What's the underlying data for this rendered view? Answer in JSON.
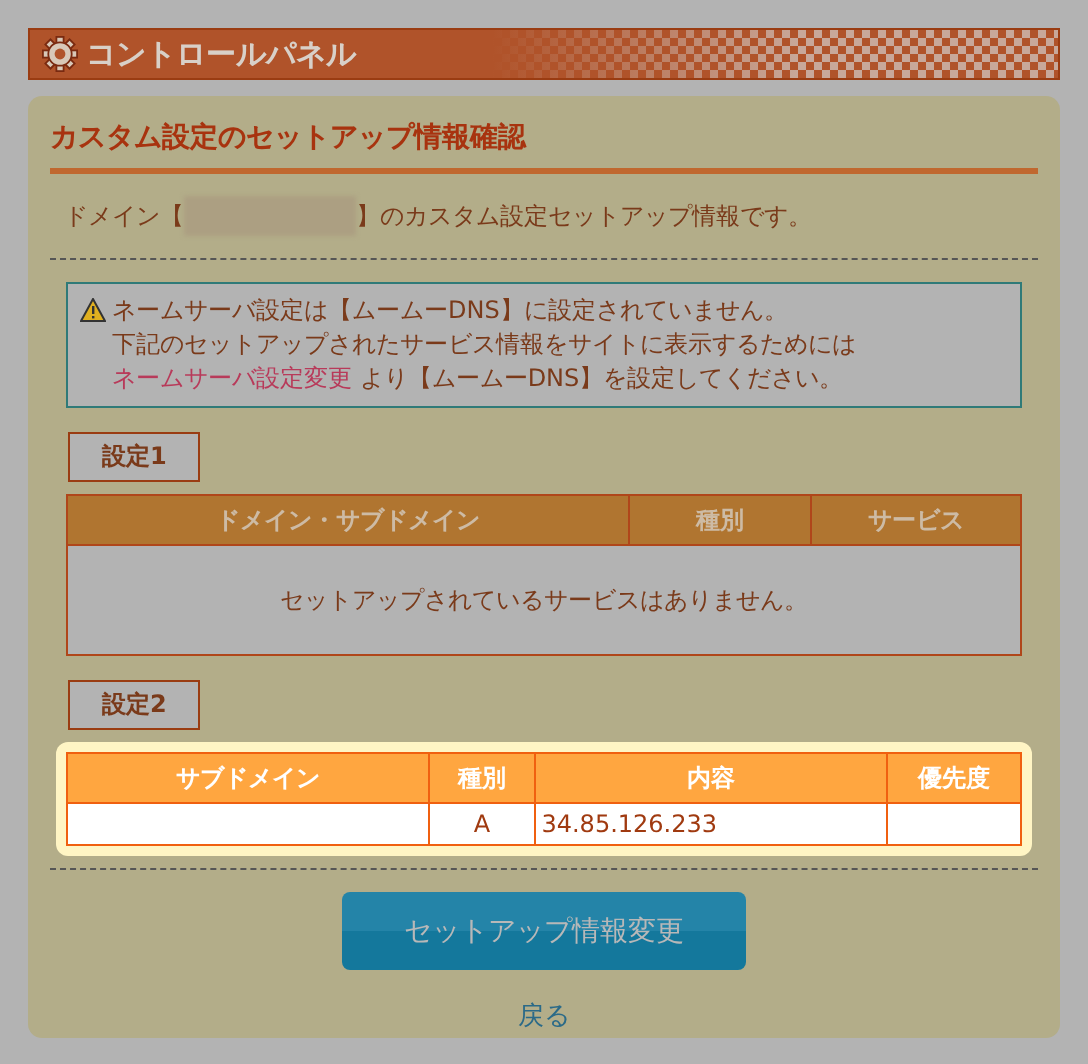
{
  "header": {
    "title": "コントロールパネル"
  },
  "page_title": "カスタム設定のセットアップ情報確認",
  "intro": {
    "before": "ドメイン【",
    "after": "】のカスタム設定セットアップ情報です。"
  },
  "notice": {
    "line_1": "ネームサーバ設定は【ムームーDNS】に設定されていません。",
    "line_2": "下記のセットアップされたサービス情報をサイトに表示するためには",
    "link": "ネームサーバ設定変更",
    "line_3_rest": " より【ムームーDNS】を設定してください。"
  },
  "sections": [
    {
      "label": "設定1",
      "highlighted": false,
      "columns": [
        "ドメイン・サブドメイン",
        "種別",
        "サービス"
      ],
      "empty_message": "セットアップされているサービスはありません。"
    },
    {
      "label": "設定2",
      "highlighted": true,
      "columns": [
        "サブドメイン",
        "種別",
        "内容",
        "優先度"
      ],
      "rows": [
        [
          "",
          "A",
          "34.85.126.233",
          ""
        ]
      ]
    }
  ],
  "button": "セットアップ情報変更",
  "back_link": "戻る"
}
